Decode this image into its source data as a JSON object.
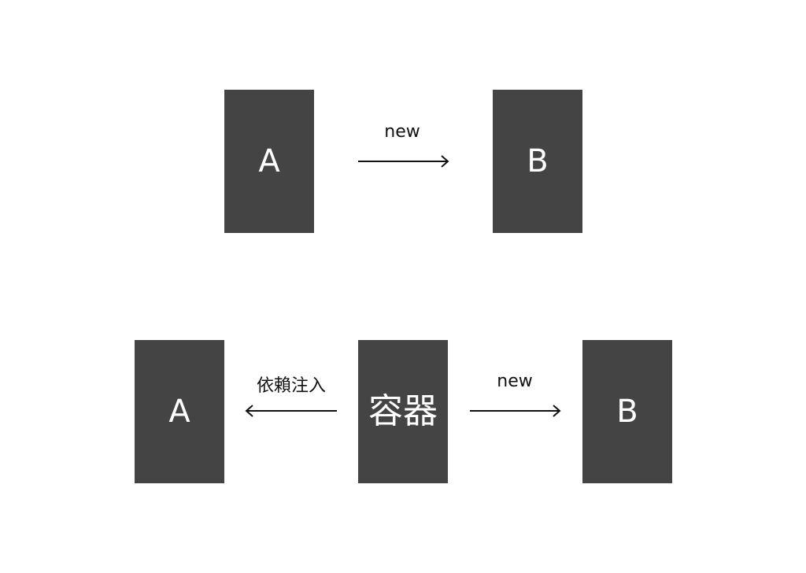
{
  "top_row": {
    "box_a": "A",
    "box_b": "B",
    "arrow_label": "new"
  },
  "bottom_row": {
    "box_a": "A",
    "box_container": "容器",
    "box_b": "B",
    "left_arrow_label": "依賴注入",
    "right_arrow_label": "new"
  },
  "colors": {
    "box_fill": "#444444",
    "box_text": "#ffffff",
    "arrow": "#111111",
    "background": "#ffffff"
  }
}
